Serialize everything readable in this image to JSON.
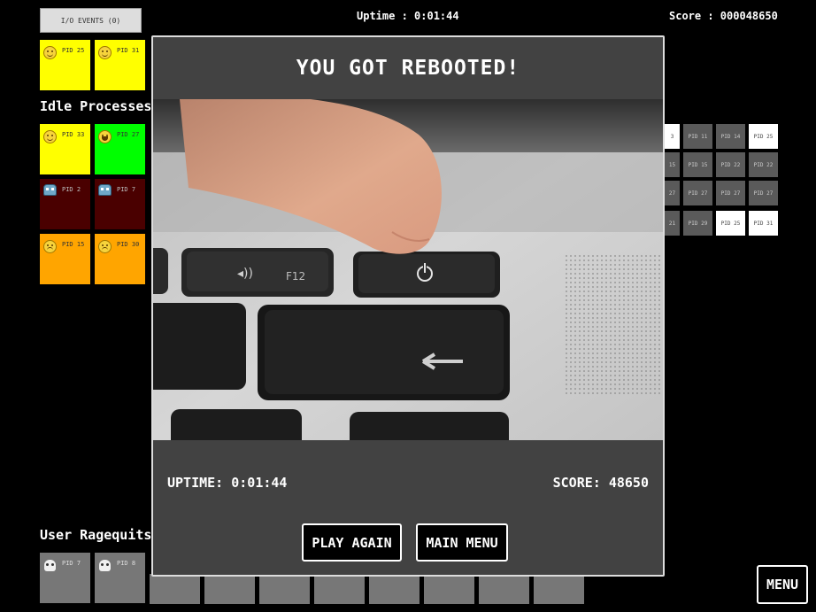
{
  "hud": {
    "io_events_label": "I/O EVENTS (0)",
    "uptime": "Uptime : 0:01:44",
    "score": "Score : 000048650"
  },
  "sections": {
    "idle": "Idle Processes",
    "ragequits": "User Ragequits"
  },
  "cpu_processes": [
    {
      "pid": "PID 25",
      "mood": "smile-icon",
      "color": "#ffff00"
    },
    {
      "pid": "PID 31",
      "mood": "smile-icon",
      "color": "#ffff00"
    }
  ],
  "idle_processes": [
    {
      "pid": "PID 33",
      "mood": "smile-icon",
      "color": "#ffff00"
    },
    {
      "pid": "PID 27",
      "mood": "grin-icon",
      "color": "#00ff00"
    },
    {
      "pid": "PID 2",
      "mood": "robot-icon",
      "color": "#4a0000"
    },
    {
      "pid": "PID 7",
      "mood": "robot-icon",
      "color": "#4a0000"
    },
    {
      "pid": "PID 15",
      "mood": "neutral-face-icon",
      "color": "#ffa500"
    },
    {
      "pid": "PID 30",
      "mood": "neutral-face-icon",
      "color": "#ffa500"
    }
  ],
  "memory_rows": [
    [
      "3",
      "PID 11",
      "PID 14",
      "PID 25"
    ],
    [
      "15",
      "PID 15",
      "PID 22",
      "PID 22"
    ],
    [
      "27",
      "PID 27",
      "PID 27",
      "PID 27"
    ],
    [
      "21",
      "PID 29",
      "PID 25",
      "PID 31"
    ]
  ],
  "ragequits": [
    {
      "pid": "PID 7",
      "icon": "skull-icon"
    },
    {
      "pid": "PID 8",
      "icon": "skull-icon"
    }
  ],
  "modal": {
    "title": "YOU GOT REBOOTED!",
    "uptime": "UPTIME: 0:01:44",
    "score": "SCORE: 48650",
    "play_again": "PLAY AGAIN",
    "main_menu": "MAIN MENU",
    "photo_key_label": "F12"
  },
  "menu_label": "MENU"
}
